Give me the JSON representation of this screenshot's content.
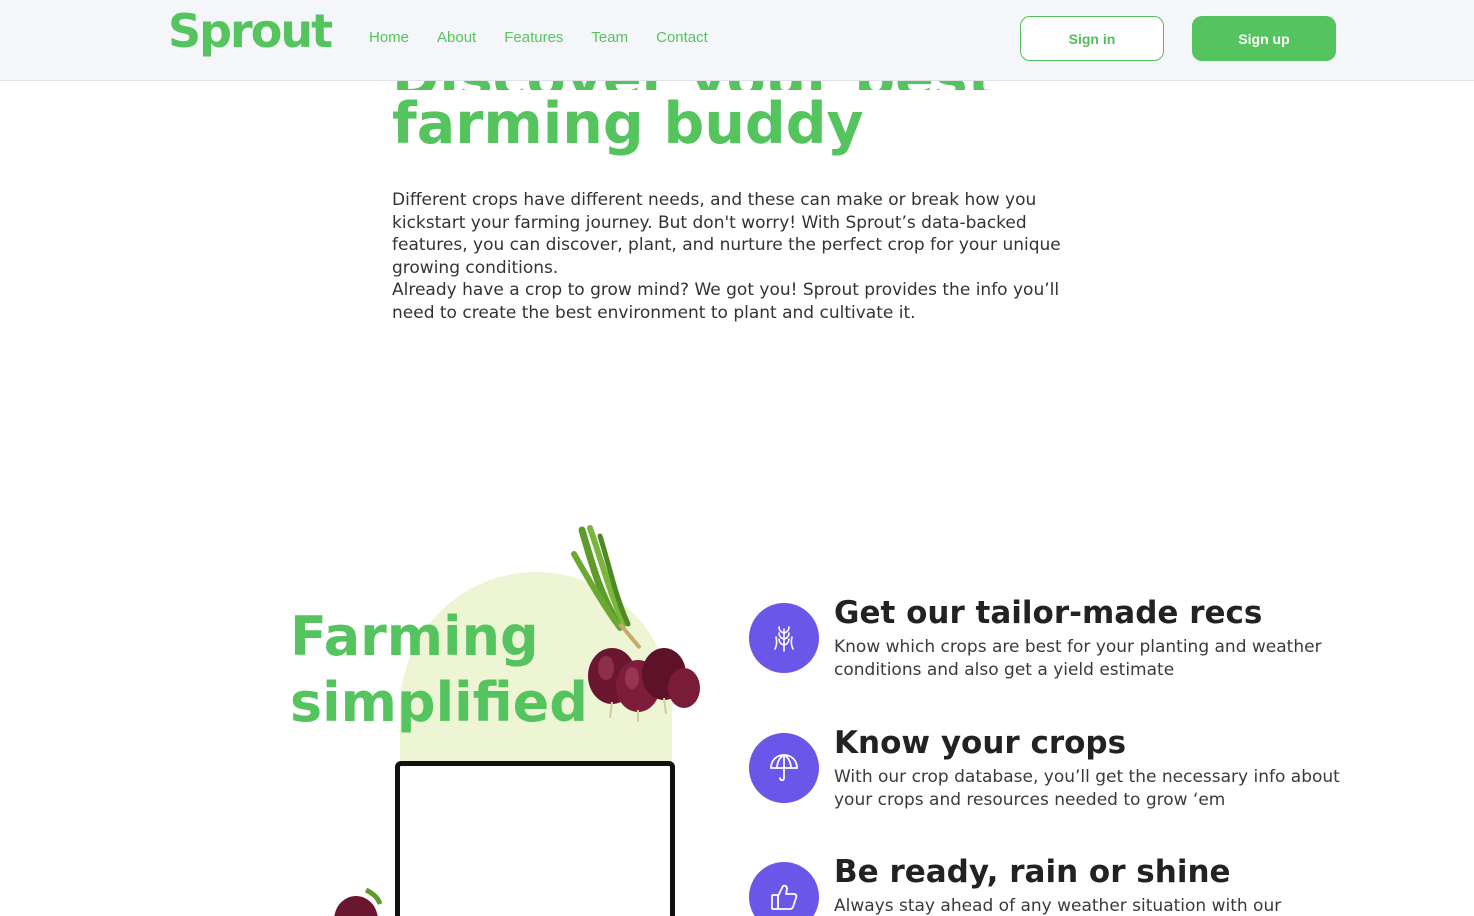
{
  "header": {
    "logo": "Sprout",
    "nav": [
      "Home",
      "About",
      "Features",
      "Team",
      "Contact"
    ],
    "signin_label": "Sign in",
    "signup_label": "Sign up"
  },
  "hero": {
    "title_line1": "Discover your best",
    "title_line2": "farming buddy",
    "para1": "Different crops have different needs, and these can make or break how you kickstart your farming journey. But don't worry! With Sprout’s data-backed features, you can discover, plant, and nurture the perfect crop for your unique growing conditions.",
    "para2": "Already have a crop to grow mind? We got you! Sprout provides the info you’ll need to create the best environment to plant and cultivate it."
  },
  "simplified": {
    "title_line1": "Farming",
    "title_line2": "simplified"
  },
  "features": [
    {
      "icon": "wheat-icon",
      "title": "Get our tailor-made recs",
      "desc": "Know which crops are best for your planting and weather conditions and also get a yield estimate"
    },
    {
      "icon": "umbrella-icon",
      "title": "Know your crops",
      "desc": "With our crop database, you’ll get the necessary info about your crops and resources needed to grow ‘em"
    },
    {
      "icon": "thumbs-up-icon",
      "title": "Be ready, rain or shine",
      "desc": "Always stay ahead of any weather situation with our"
    }
  ],
  "colors": {
    "brand_green": "#55c45e",
    "accent_purple": "#6a56e8",
    "arch_bg": "#eef5d4"
  }
}
